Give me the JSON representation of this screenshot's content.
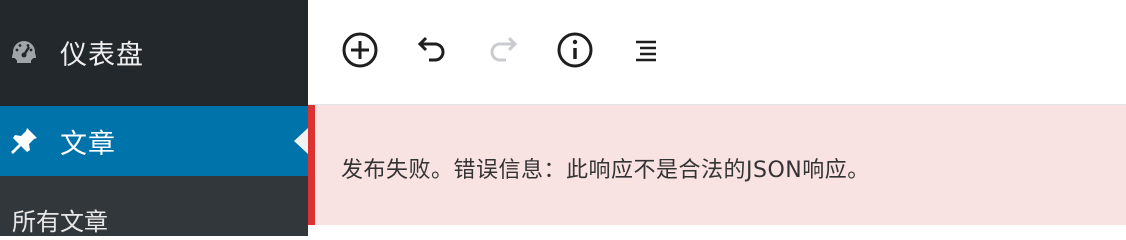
{
  "sidebar": {
    "items": [
      {
        "label": "仪表盘",
        "icon": "dashboard-icon"
      },
      {
        "label": "文章",
        "icon": "pin-icon",
        "active": true
      }
    ],
    "submenu": [
      {
        "label": "所有文章"
      }
    ]
  },
  "toolbar": {
    "tools": [
      "add-block-icon",
      "undo-icon",
      "redo-icon",
      "info-icon",
      "outline-icon"
    ]
  },
  "notice": {
    "message": "发布失败。错误信息：此响应不是合法的JSON响应。",
    "color": "#dc3232"
  },
  "colors": {
    "sidebar": "#23282d",
    "active": "#0073aa",
    "notice_bg": "#f9e2e2"
  }
}
